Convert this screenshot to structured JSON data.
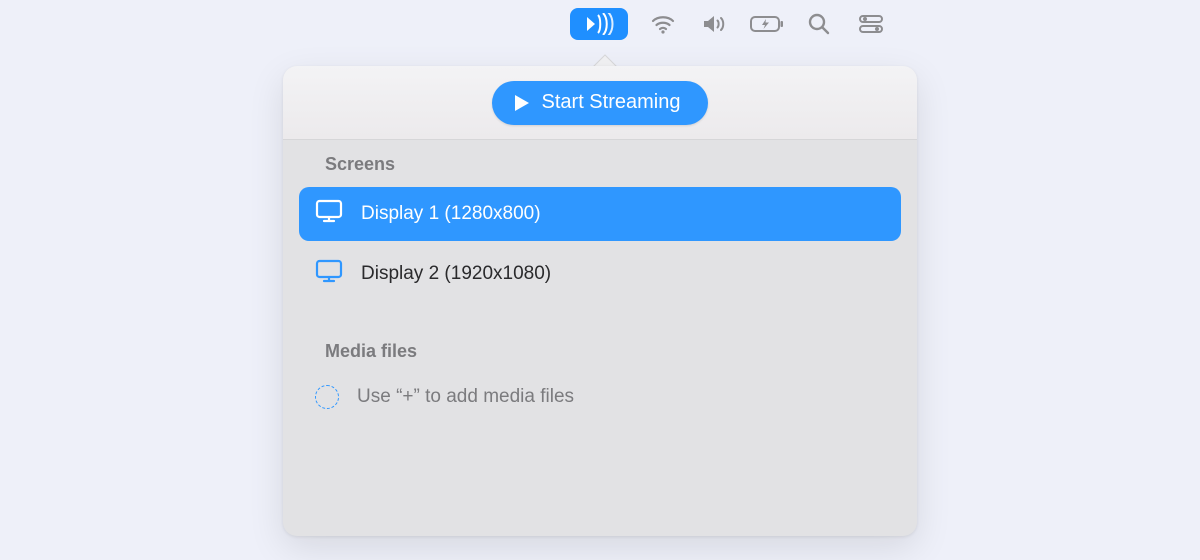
{
  "menubar": {
    "active_icon": "streaming-icon"
  },
  "popover": {
    "start_button": "Start Streaming",
    "screens": {
      "title": "Screens",
      "items": [
        {
          "label": "Display 1 (1280x800)",
          "selected": true
        },
        {
          "label": "Display 2 (1920x1080)",
          "selected": false
        }
      ]
    },
    "media": {
      "title": "Media files",
      "empty_hint": "Use “+” to add media files"
    }
  }
}
